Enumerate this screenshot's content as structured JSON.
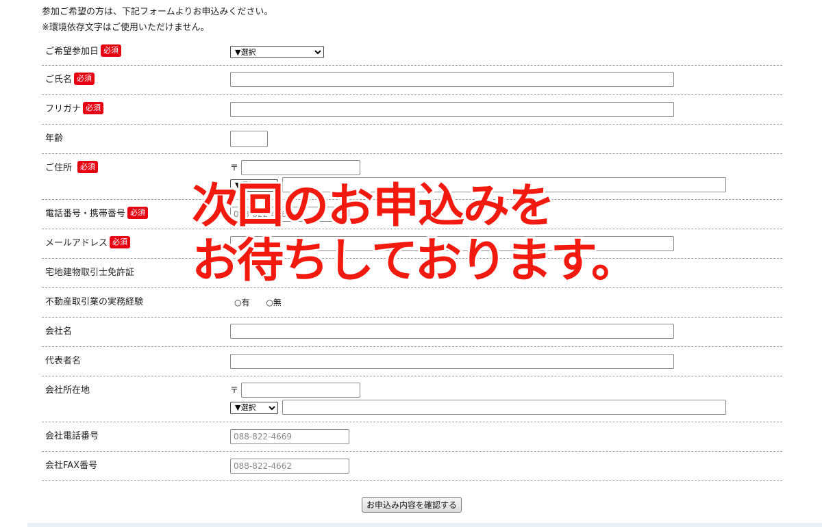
{
  "intro": {
    "line1": "参加ご希望の方は、下記フォームよりお申込みください。",
    "line2": "※環境依存文字はご使用いただけません。"
  },
  "required_badge": "必須",
  "form": {
    "date": {
      "label": "ご希望参加日",
      "select_value": "▼選択"
    },
    "name": {
      "label": "ご氏名"
    },
    "kana": {
      "label": "フリガナ"
    },
    "age": {
      "label": "年齢"
    },
    "address": {
      "label": "ご住所",
      "zip_mark": "〒",
      "pref_value": "▼選択"
    },
    "phone": {
      "label": "電話番号・携帯番号",
      "placeholder": "088-822-4669"
    },
    "email": {
      "label": "メールアドレス"
    },
    "license": {
      "label": "宅地建物取引士免許証"
    },
    "experience": {
      "label": "不動産取引業の実務経験",
      "option_yes": "○有",
      "option_no": "○無"
    },
    "company": {
      "label": "会社名"
    },
    "representative": {
      "label": "代表者名"
    },
    "company_address": {
      "label": "会社所在地",
      "zip_mark": "〒",
      "pref_value": "▼選択"
    },
    "company_phone": {
      "label": "会社電話番号",
      "placeholder": "088-822-4669"
    },
    "company_fax": {
      "label": "会社FAX番号",
      "placeholder": "088-822-4662"
    }
  },
  "submit_label": "お申込み内容を確認する",
  "overlay": {
    "line1": "次回のお申込みを",
    "line2": "お待ちしております。"
  },
  "colors": {
    "required": "#e60012",
    "overlay_text": "#f21a0f"
  }
}
